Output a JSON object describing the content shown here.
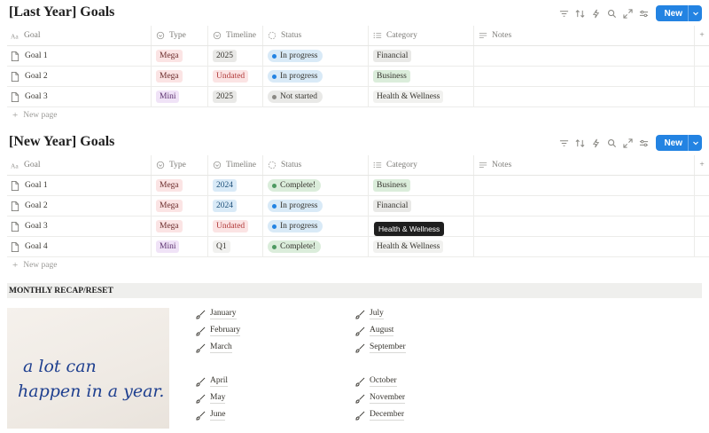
{
  "toolbar_icons": [
    "filter-icon",
    "sort-icon",
    "lightning-icon",
    "search-icon",
    "expand-icon",
    "settings-icon"
  ],
  "new_label": "New",
  "columns": {
    "goal": "Goal",
    "type": "Type",
    "timeline": "Timeline",
    "status": "Status",
    "category": "Category",
    "notes": "Notes"
  },
  "new_page_label": "New page",
  "last_year": {
    "title": "[Last Year] Goals",
    "rows": [
      {
        "goal": "Goal 1",
        "type": "Mega",
        "timeline": "2025",
        "status": "In progress",
        "category": "Financial"
      },
      {
        "goal": "Goal 2",
        "type": "Mega",
        "timeline": "Undated",
        "status": "In progress",
        "category": "Business"
      },
      {
        "goal": "Goal 3",
        "type": "Mini",
        "timeline": "2025",
        "status": "Not started",
        "category": "Health & Wellness"
      }
    ]
  },
  "new_year": {
    "title": "[New Year] Goals",
    "rows": [
      {
        "goal": "Goal 1",
        "type": "Mega",
        "timeline": "2024",
        "status": "Complete!",
        "category": "Business"
      },
      {
        "goal": "Goal 2",
        "type": "Mega",
        "timeline": "2024",
        "status": "In progress",
        "category": "Financial"
      },
      {
        "goal": "Goal 3",
        "type": "Mega",
        "timeline": "Undated",
        "status": "In progress",
        "category": ""
      },
      {
        "goal": "Goal 4",
        "type": "Mini",
        "timeline": "Q1",
        "status": "Complete!",
        "category": "Health & Wellness"
      }
    ]
  },
  "tooltip": "Health & Wellness",
  "recap": {
    "banner": "MONTHLY RECAP/RESET",
    "months_left": [
      "January",
      "February",
      "March",
      "April",
      "May",
      "June"
    ],
    "months_right": [
      "July",
      "August",
      "September",
      "October",
      "November",
      "December"
    ]
  },
  "photo": {
    "handwriting": "a lot can happen in a year."
  },
  "colors": {
    "accent": "#2383e2",
    "mega_bg": "#fbe4e4",
    "mega_fg": "#6b2a2a",
    "mini_bg": "#f0e3f7",
    "mini_fg": "#5a2f6e",
    "year_bg": "#e9e9e7",
    "year_blue_bg": "#d9eaf7",
    "undated_bg": "#fbe4e4",
    "undated_fg": "#b13a3a",
    "progress_bg": "#d9eaf7",
    "progress_dot": "#2383e2",
    "complete_bg": "#dbeddb",
    "complete_dot": "#4d9960",
    "notstarted_bg": "#e9e9e7",
    "notstarted_dot": "#8a8984",
    "financial_bg": "#e9e9e7",
    "business_bg": "#dbeddb"
  }
}
